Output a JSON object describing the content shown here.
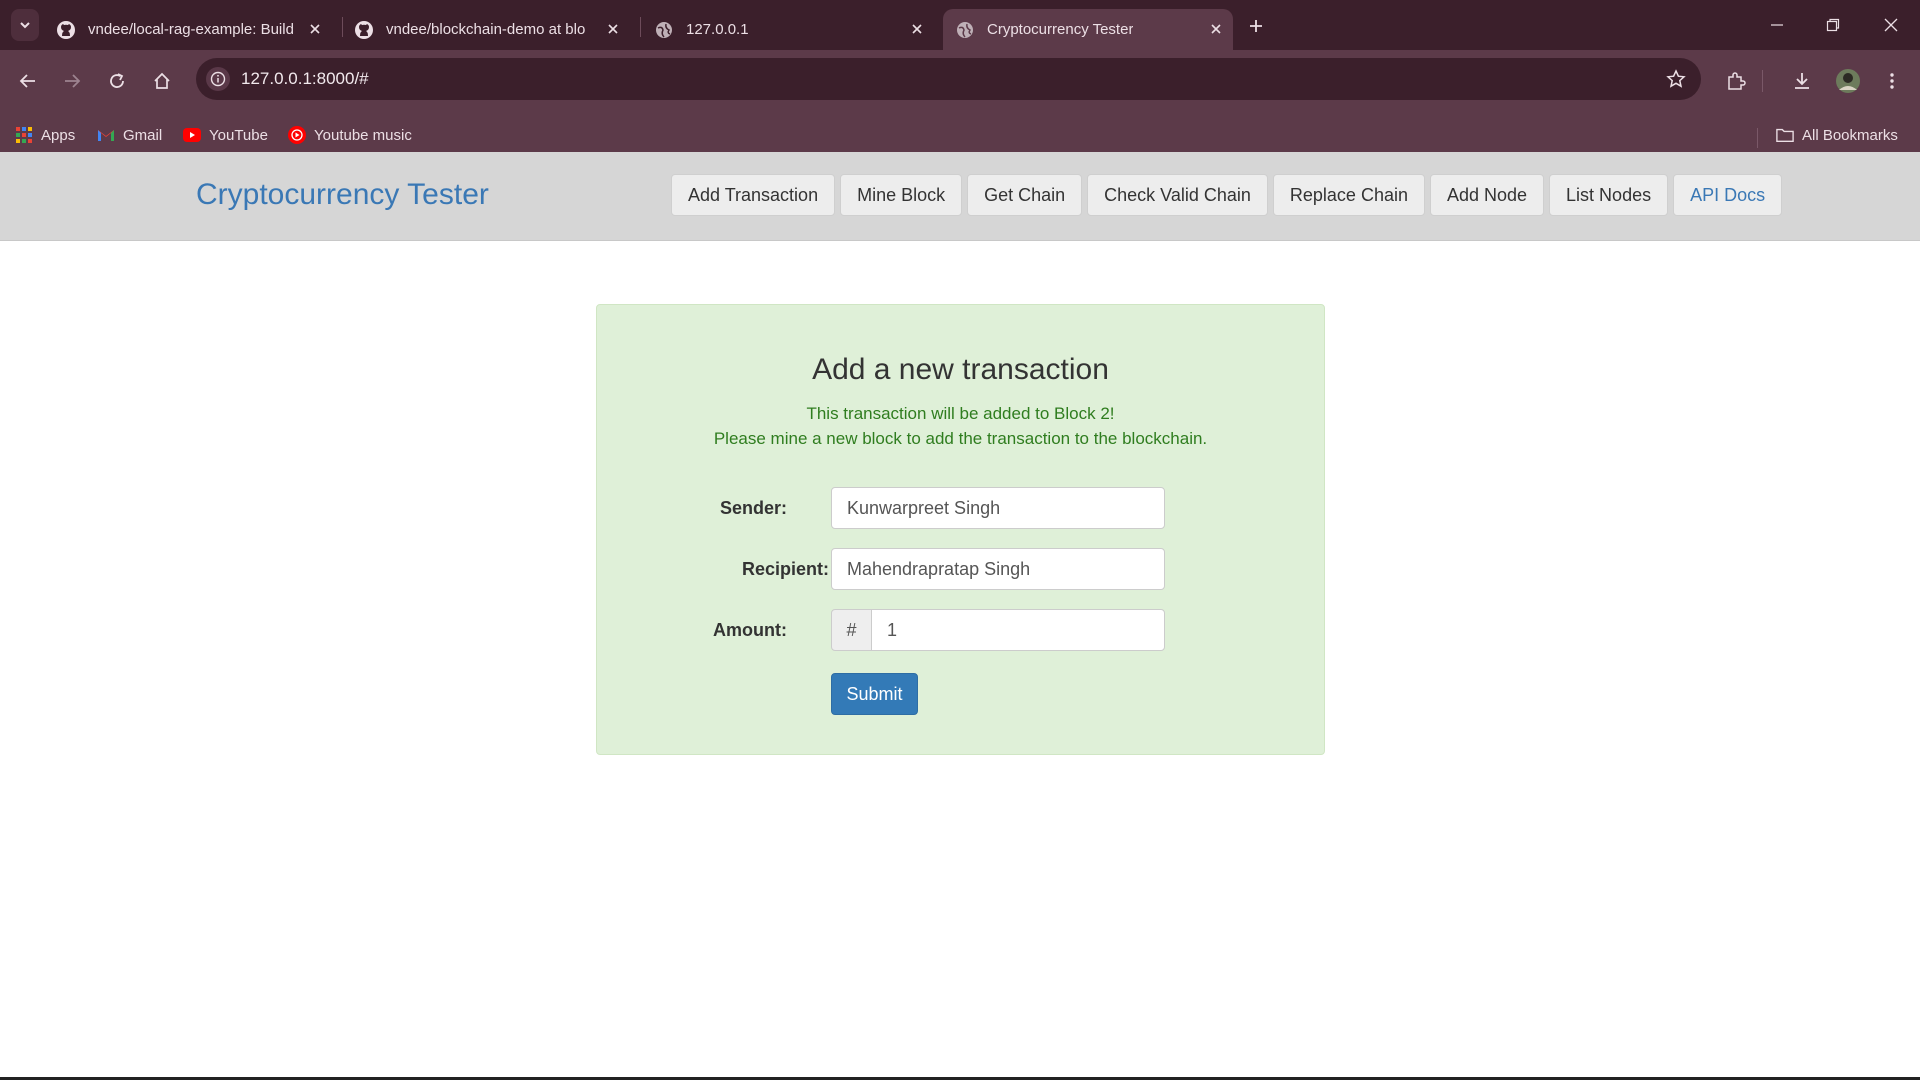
{
  "browser": {
    "tabs": [
      {
        "title": "vndee/local-rag-example: Build",
        "icon": "github-icon",
        "active": false
      },
      {
        "title": "vndee/blockchain-demo at blo",
        "icon": "github-icon",
        "active": false
      },
      {
        "title": "127.0.0.1",
        "icon": "globe-icon",
        "active": false
      },
      {
        "title": "Cryptocurrency Tester",
        "icon": "globe-icon",
        "active": true
      }
    ],
    "url": "127.0.0.1:8000/#",
    "bookmarks": [
      {
        "label": "Apps",
        "icon": "apps-grid-icon"
      },
      {
        "label": "Gmail",
        "icon": "gmail-icon"
      },
      {
        "label": "YouTube",
        "icon": "youtube-icon"
      },
      {
        "label": "Youtube music",
        "icon": "youtube-music-icon"
      }
    ],
    "all_bookmarks": "All Bookmarks",
    "colors": {
      "frame": "#3b1f2b",
      "toolbar": "#5c3a49"
    }
  },
  "app": {
    "brand": "Cryptocurrency Tester",
    "nav": [
      "Add Transaction",
      "Mine Block",
      "Get Chain",
      "Check Valid Chain",
      "Replace Chain",
      "Add Node",
      "List Nodes",
      "API Docs"
    ],
    "colors": {
      "brand": "#3a78b5",
      "panel": "#dff0d8",
      "note": "#2f7d1f",
      "primary": "#337ab7"
    }
  },
  "form": {
    "title": "Add a new transaction",
    "note_line1": "This transaction will be added to Block 2!",
    "note_line2": "Please mine a new block to add the transaction to the blockchain.",
    "sender_label": "Sender:",
    "sender_value": "Kunwarpreet Singh",
    "recipient_label": "Recipient:",
    "recipient_value": "Mahendrapratap Singh",
    "amount_label": "Amount:",
    "amount_addon": "#",
    "amount_value": "1",
    "submit_label": "Submit"
  }
}
